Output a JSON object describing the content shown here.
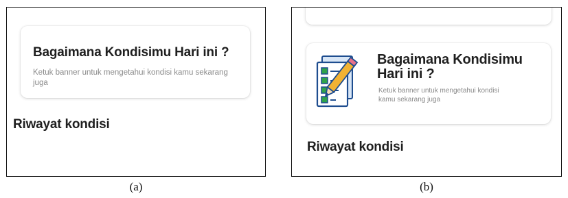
{
  "panel_a": {
    "card": {
      "title": "Bagaimana Kondisimu Hari ini ?",
      "subtitle": "Ketuk banner untuk mengetahui kondisi kamu sekarang juga"
    },
    "section_title": "Riwayat kondisi",
    "caption": "(a)"
  },
  "panel_b": {
    "card": {
      "icon": "checklist-pencil-icon",
      "title": "Bagaimana Kondisimu Hari ini ?",
      "subtitle": "Ketuk banner untuk mengetahui kondisi kamu sekarang juga"
    },
    "section_title": "Riwayat kondisi",
    "caption": "(b)"
  },
  "colors": {
    "text_primary": "#1f1f1f",
    "text_secondary": "#8a8a8a",
    "icon_blue": "#1e4d8f",
    "icon_green": "#2fa34a",
    "pencil_yellow": "#f2b233"
  }
}
